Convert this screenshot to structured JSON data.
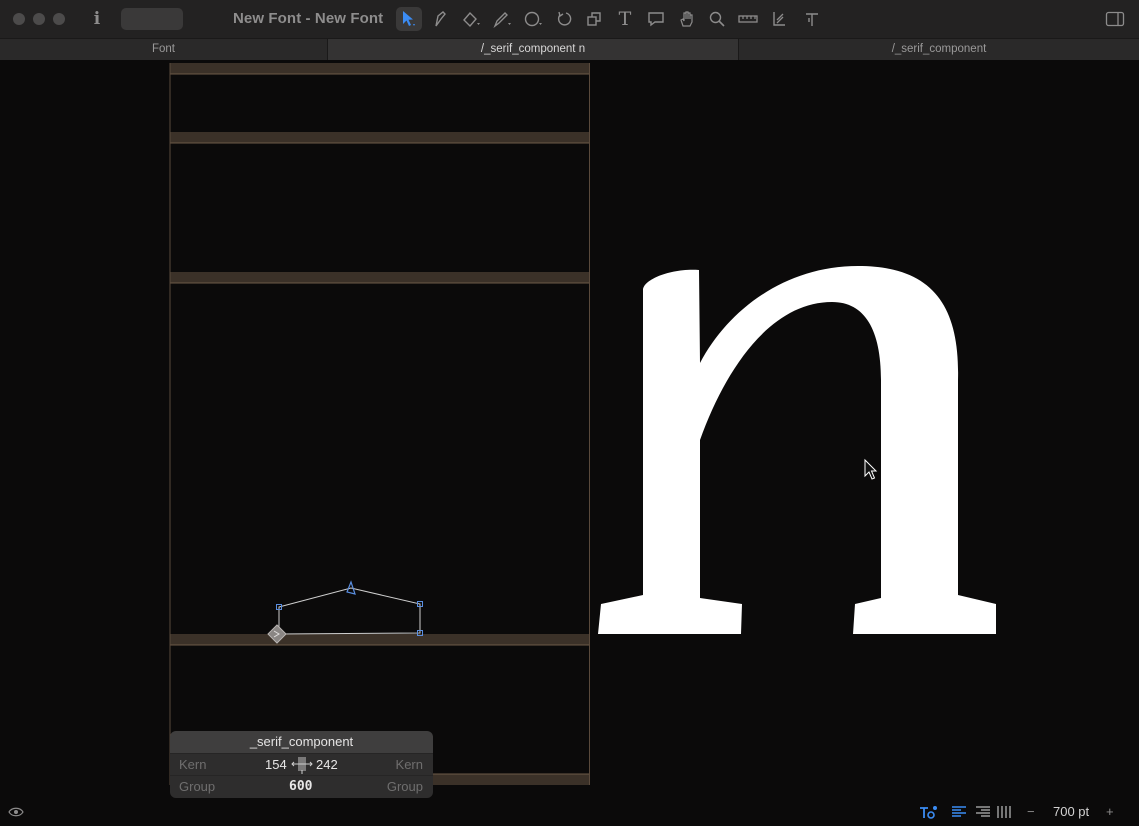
{
  "window": {
    "title": "New Font - New Font"
  },
  "toolbar": {
    "tools": [
      "select-tool-icon",
      "pen-tool-icon",
      "draw-tool-icon",
      "pencil-tool-icon",
      "shape-tool-icon",
      "rotate-tool-icon",
      "scale-tool-icon",
      "text-tool-icon",
      "annotation-tool-icon",
      "hand-tool-icon",
      "zoom-tool-icon",
      "measure-tool-icon",
      "anchor-tool-icon",
      "type-tool-icon"
    ],
    "active_tool": "select-tool-icon"
  },
  "tabs": [
    {
      "label": "Font",
      "active": false
    },
    {
      "label": "/_serif_component n",
      "active": true
    },
    {
      "label": "/_serif_component",
      "active": false
    }
  ],
  "glyph": {
    "preview_char": "n"
  },
  "info_panel": {
    "name": "_serif_component",
    "kern_label_left": "Kern",
    "kern_label_right": "Kern",
    "lsb": "154",
    "rsb": "242",
    "group_label_left": "Group",
    "group_label_right": "Group",
    "width": "600"
  },
  "statusbar": {
    "zoom": "700 pt",
    "minus": "−",
    "plus": "+"
  },
  "colors": {
    "accent": "#3b8cf4",
    "metric_band": "#3b3128",
    "glyph_fill": "#ffffff",
    "canvas_bg": "#0b0a0a"
  }
}
